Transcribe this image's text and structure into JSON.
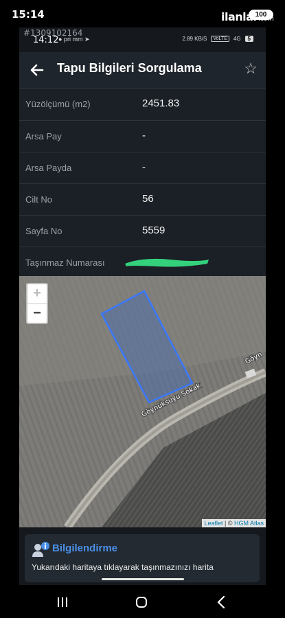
{
  "outer_status": {
    "time": "15:14",
    "watermark": "ilanlar",
    "watermark_suffix": ".com",
    "battery": "100"
  },
  "inner_status": {
    "listing_id": "#1309102164",
    "time": "14:12",
    "icons": "pri mm",
    "speed": "2.89 KB/S",
    "volte": "VoLTE",
    "network": "4G",
    "battery": "5"
  },
  "app": {
    "title": "Tapu Bilgileri Sorgulama"
  },
  "fields": [
    {
      "label": "Yüzölçümü (m2)",
      "value": "2451.83"
    },
    {
      "label": "Arsa Pay",
      "value": "-"
    },
    {
      "label": "Arsa Payda",
      "value": "-"
    },
    {
      "label": "Cilt No",
      "value": "56"
    },
    {
      "label": "Sayfa No",
      "value": "5559"
    },
    {
      "label": "Taşınmaz Numarası",
      "value": ""
    }
  ],
  "map": {
    "street_label": "Göynüksuyu Sokak",
    "street_label_2": "Göyn",
    "zoom_in": "+",
    "zoom_out": "−",
    "attribution_leaflet": "Leaflet",
    "attribution_sep": " | © ",
    "attribution_hgm": "HGM Atlas"
  },
  "info": {
    "title": "Bilgilendirme",
    "text": "Yukarıdaki haritaya tıklayarak taşınmazınızı harita"
  },
  "colors": {
    "parcel_outline": "#3a78ff",
    "info_title": "#4a8fe7",
    "redaction": "#34d17c"
  }
}
